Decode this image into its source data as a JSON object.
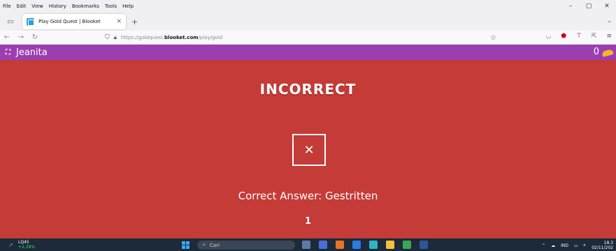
{
  "menubar": {
    "items": [
      "File",
      "Edit",
      "View",
      "History",
      "Bookmarks",
      "Tools",
      "Help"
    ]
  },
  "window_controls": {
    "minimize": "–",
    "maximize": "▢",
    "close": "✕"
  },
  "tabs": {
    "active_title": "Play Gold Quest | Blooket",
    "close_glyph": "×",
    "new_tab_glyph": "+",
    "overflow_glyph": "⌄"
  },
  "nav": {
    "back": "←",
    "forward": "→",
    "reload": "↻",
    "url_prefix": "https://goldquest.",
    "url_domain": "blooket.com",
    "url_path": "/play/gold",
    "bookmark_star": "☆"
  },
  "game_header": {
    "fullscreen_glyph": "⛶",
    "player_name": "Jeanita",
    "gold": "0"
  },
  "feedback": {
    "title": "INCORRECT",
    "icon_glyph": "✕",
    "correct_answer": "Correct Answer: Gestritten",
    "counter": "1"
  },
  "taskbar": {
    "stock_symbol": "LQ45",
    "stock_change": "+2,28%",
    "search_placeholder": "Cari",
    "language": "IND",
    "time": "18.3",
    "date": "02/11/202"
  },
  "colors": {
    "header_purple": "#9b3eb0",
    "incorrect_red": "#c43b37",
    "gold": "#f5b52c",
    "taskbar": "#1c2a3a"
  }
}
